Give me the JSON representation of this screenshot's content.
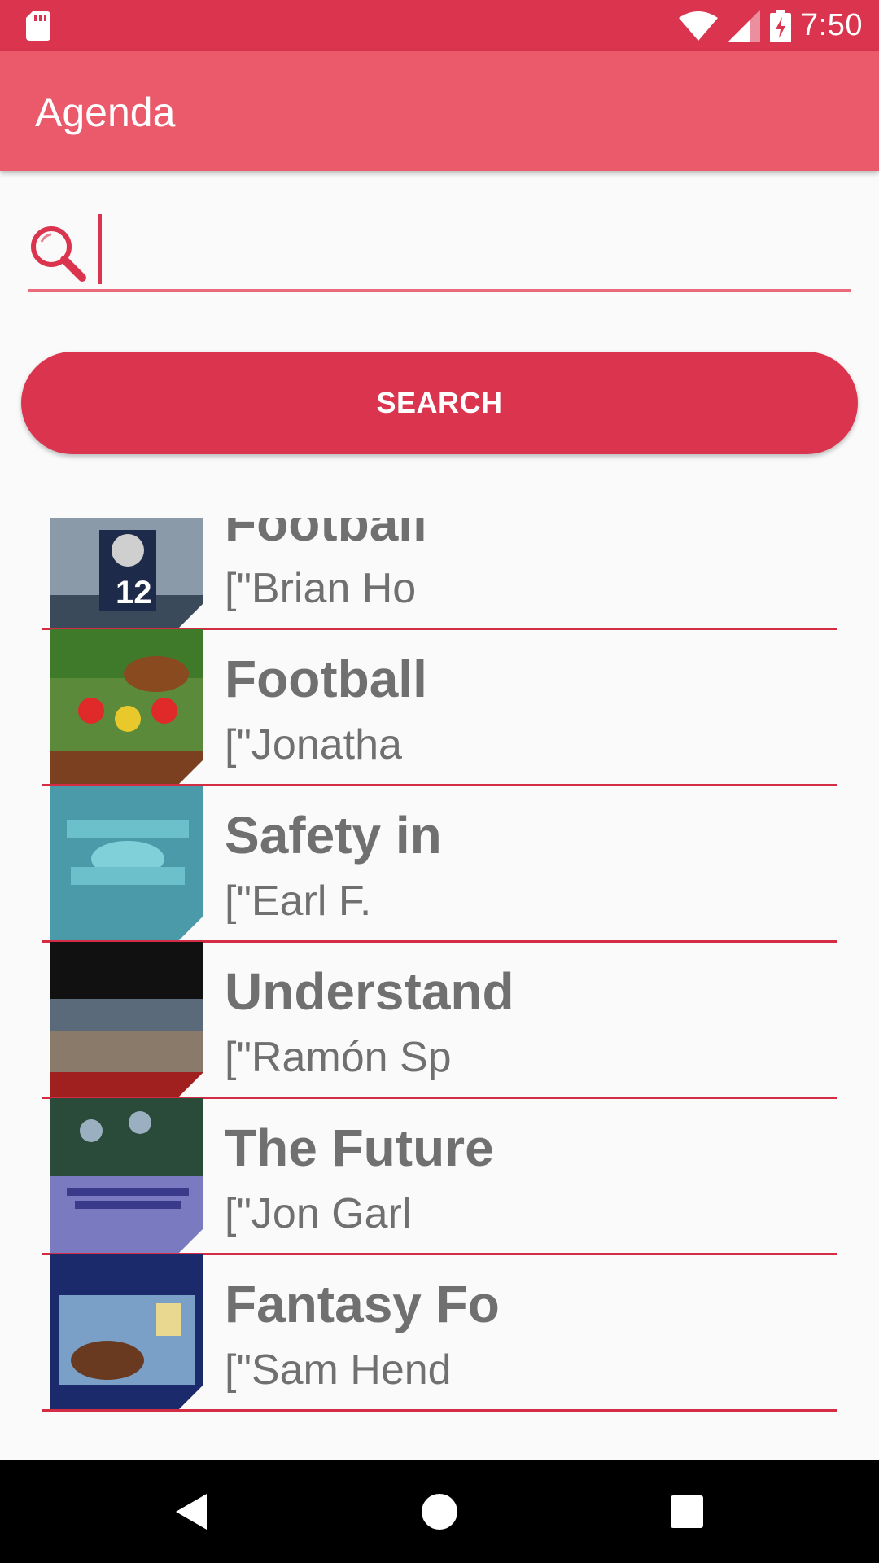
{
  "status_bar": {
    "time": "7:50"
  },
  "app_bar": {
    "title": "Agenda"
  },
  "search": {
    "value": "",
    "placeholder": "",
    "button_label": "SEARCH"
  },
  "colors": {
    "accent": "#db344f",
    "app_bar": "#ea5a6a",
    "text": "#707070"
  },
  "books": [
    {
      "title": "Football",
      "author": "[\"Brian Ho",
      "cover": "quarterback-photo"
    },
    {
      "title": "Football",
      "author": "[\"Jonatha",
      "cover": "football-players-illustration"
    },
    {
      "title": "Safety in",
      "author": "[\"Earl F.",
      "cover": "american-football-teal-cover"
    },
    {
      "title": "Understand",
      "author": "[\"Ramón Sp",
      "cover": "stadium-crowd-cover"
    },
    {
      "title": "The Future",
      "author": "[\"Jon Garl",
      "cover": "future-of-football-cover"
    },
    {
      "title": "Fantasy Fo",
      "author": "[\"Sam Hend",
      "cover": "fantasy-football-cover"
    }
  ]
}
